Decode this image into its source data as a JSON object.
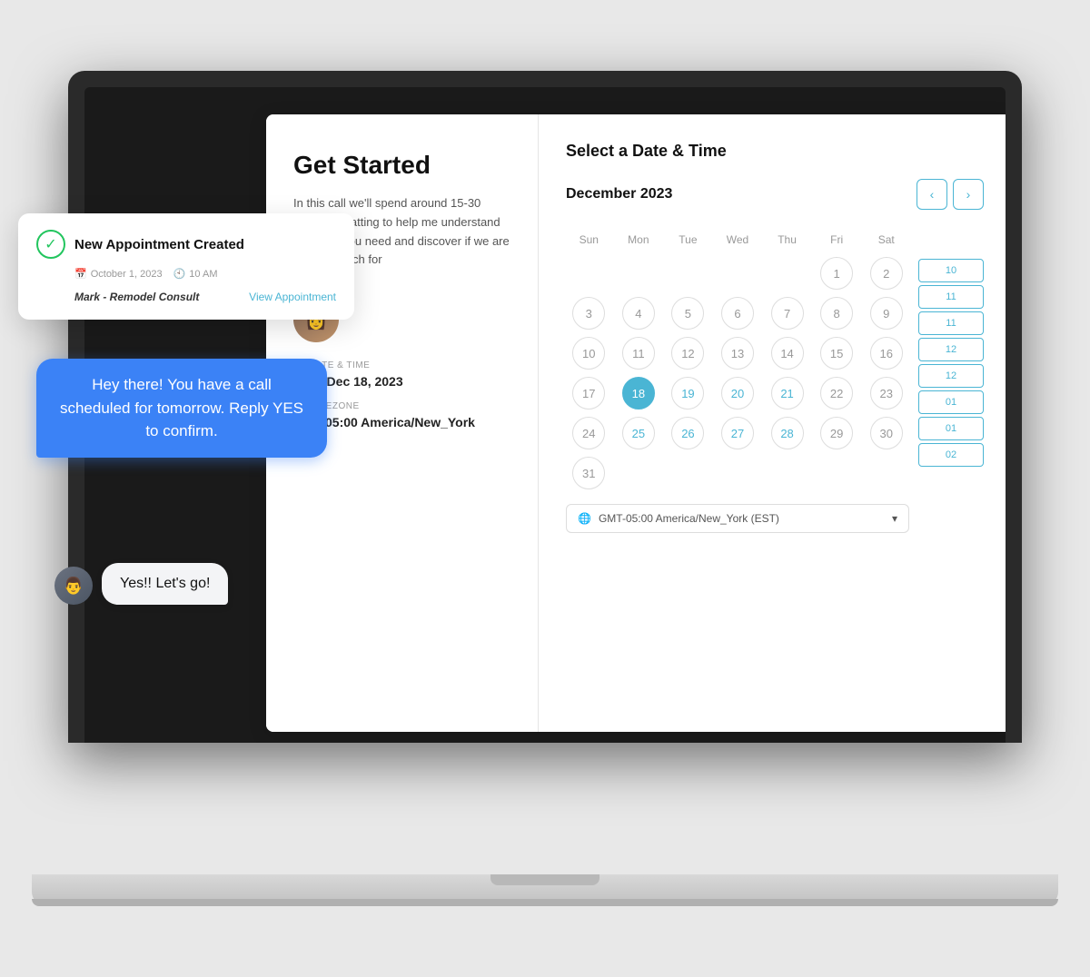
{
  "page": {
    "background": "#e8e8e8"
  },
  "notification": {
    "title": "New Appointment Created",
    "date": "October 1, 2023",
    "time": "10 AM",
    "client": "Mark - Remodel Consult",
    "link": "View Appointment",
    "check_symbol": "✓"
  },
  "chat": {
    "outgoing_message": "Hey there! You have a call scheduled for tomorrow. Reply YES to confirm.",
    "incoming_message": "Yes!! Let's go!"
  },
  "left_panel": {
    "title": "Get Started",
    "description": "In this call we'll spend around 15-30 minutes chatting to help me understand what it is you need and discover if we are a good match for",
    "date_label": "DATE & TIME",
    "date_value": "Mon, Dec 18, 2023",
    "timezone_label": "TIMEZONE",
    "timezone_value": "GMT-05:00 America/New_York (EST)",
    "calendar_icon": "📅",
    "globe_icon": "🌐"
  },
  "calendar": {
    "header": "Select a Date & Time",
    "month": "December 2023",
    "prev_label": "‹",
    "next_label": "›",
    "day_headers": [
      "Sun",
      "Mon",
      "Tue",
      "Wed",
      "Thu",
      "Fri",
      "Sat"
    ],
    "weeks": [
      [
        null,
        null,
        null,
        null,
        null,
        1,
        2
      ],
      [
        3,
        4,
        5,
        6,
        7,
        8,
        9
      ],
      [
        10,
        11,
        12,
        13,
        14,
        15,
        16
      ],
      [
        17,
        18,
        19,
        20,
        21,
        22,
        23
      ],
      [
        24,
        25,
        26,
        27,
        28,
        29,
        30
      ],
      [
        31,
        null,
        null,
        null,
        null,
        null,
        null
      ]
    ],
    "available_dates": [
      18,
      19,
      20,
      21,
      25,
      26,
      27,
      28
    ],
    "selected_date": 18,
    "time_slots": [
      "10",
      "11",
      "11",
      "12",
      "12",
      "01",
      "01",
      "02"
    ],
    "timezone_dropdown": "GMT-05:00 America/New_York (EST)"
  }
}
